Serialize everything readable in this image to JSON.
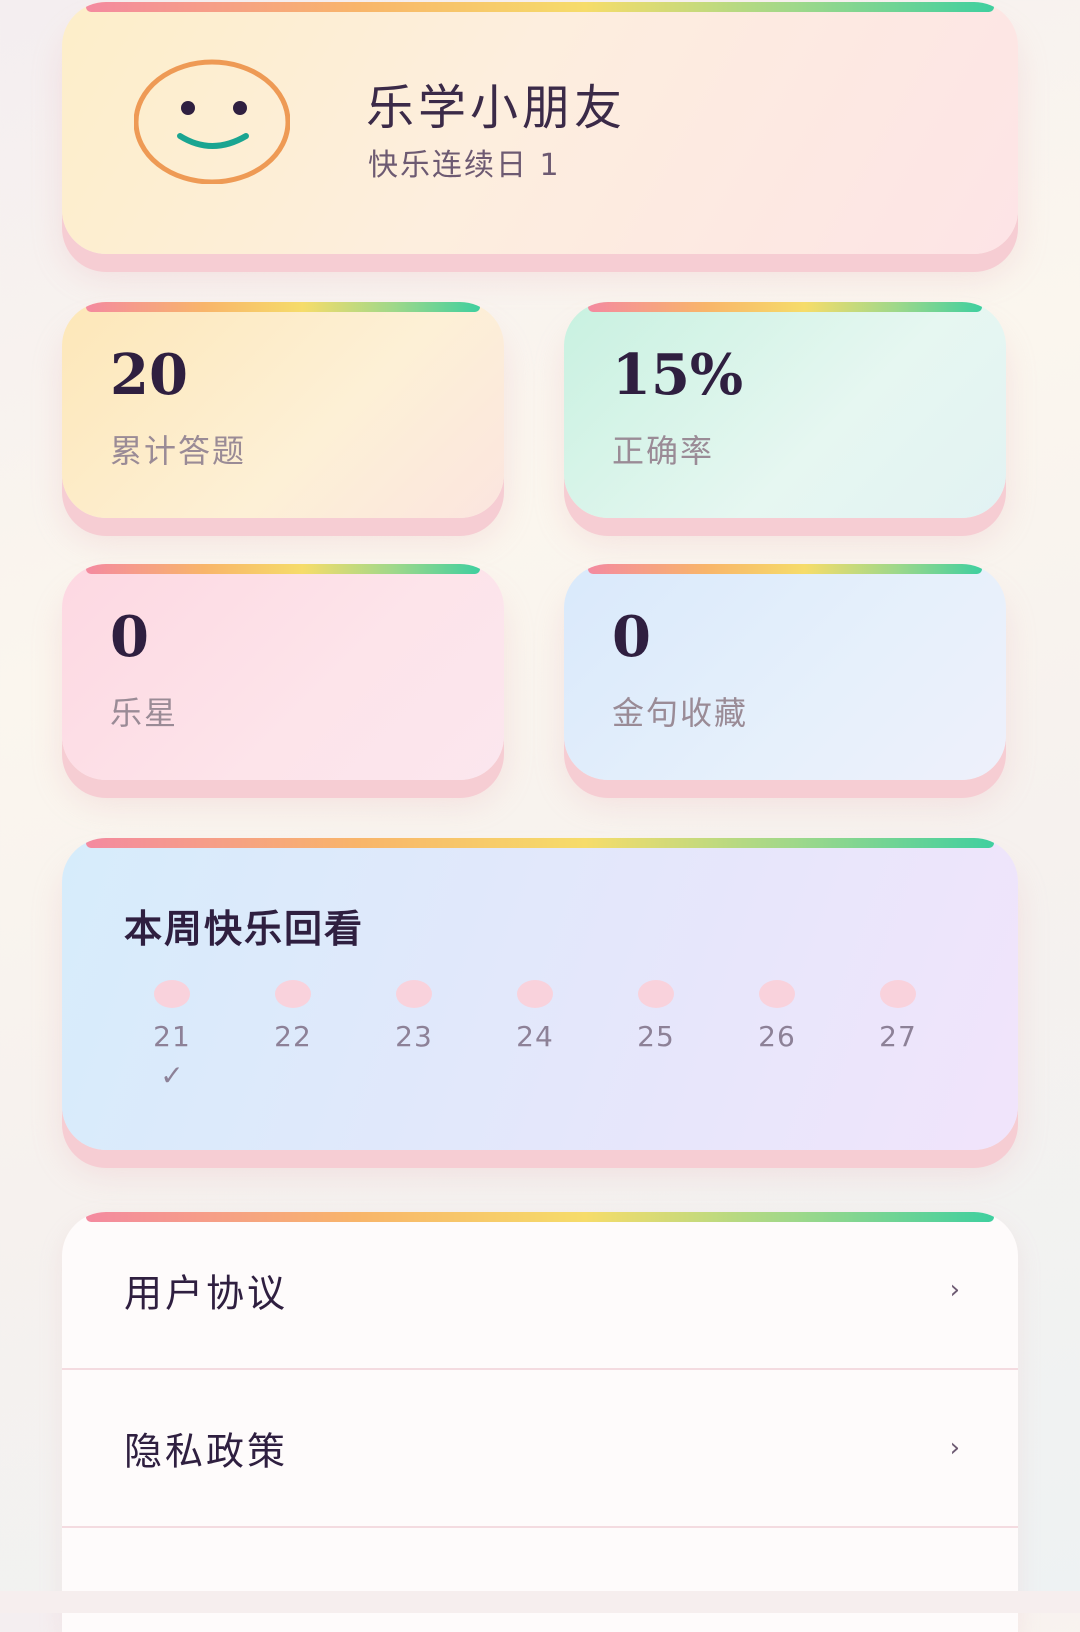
{
  "profile": {
    "username": "乐学小朋友",
    "streak_label": "快乐连续日 1",
    "avatar_icon": "smiley-face-icon"
  },
  "stats": {
    "total_answers": {
      "value": "20",
      "label": "累计答题"
    },
    "accuracy": {
      "value": "15%",
      "label": "正确率"
    },
    "stars": {
      "value": "0",
      "label": "乐星"
    },
    "quotes": {
      "value": "0",
      "label": "金句收藏"
    }
  },
  "week": {
    "title": "本周快乐回看",
    "days": [
      "21",
      "22",
      "23",
      "24",
      "25",
      "26",
      "27"
    ],
    "checked_day": "21",
    "check_mark": "✓"
  },
  "menu": {
    "items": [
      "用户协议",
      "隐私政策"
    ],
    "chevron": "›"
  },
  "colors": {
    "accent_dark": "#2f1f40",
    "muted_text": "#9a8b96",
    "day_dot": "#f9d2dc",
    "avatar_ring": "#ee9a55",
    "avatar_smile": "#1aa591"
  }
}
